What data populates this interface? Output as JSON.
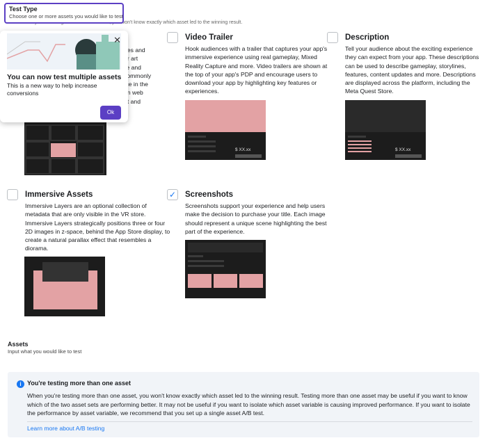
{
  "header": {
    "title": "Test Type",
    "subtitle": "Choose one or more assets you would like to test",
    "note": "Note: When you're testing more than one asset, you won't know exactly which asset led to the winning result."
  },
  "popover": {
    "title": "You can now test multiple assets",
    "body": "This is a new way to help increase conversions",
    "ok_label": "Ok",
    "close_glyph": "✕"
  },
  "hidden_card_fragments": [
    "ences and",
    "over art",
    "uare and",
    "st commonly",
    "ience in the",
    "ed in web",
    "dset and"
  ],
  "cards": {
    "video_trailer": {
      "title": "Video Trailer",
      "checked": false,
      "description": "Hook audiences with a trailer that captures your app's immersive experience using real gameplay, Mixed Reality Capture and more. Video trailers are shown at the top of your app's PDP and encourage users to download your app by highlighting key features or experiences.",
      "price": "$ XX.xx"
    },
    "description": {
      "title": "Description",
      "checked": false,
      "description": "Tell your audience about the exciting experience they can expect from your app. These descriptions can be used to describe gameplay, storylines, features, content updates and more. Descriptions are displayed across the platform, including the Meta Quest Store.",
      "price": "$ XX.xx"
    },
    "immersive_assets": {
      "title": "Immersive Assets",
      "checked": false,
      "description": "Immersive Layers are an optional collection of metadata that are only visible in the VR store. Immersive Layers strategically positions three or four 2D images in z-space, behind the App Store display, to create a natural parallax effect that resembles a diorama."
    },
    "screenshots": {
      "title": "Screenshots",
      "checked": true,
      "check_glyph": "✓",
      "description": "Screenshots support your experience and help users make the decision to purchase your title. Each image should represent a unique scene highlighting the best part of the experience."
    }
  },
  "assets": {
    "title": "Assets",
    "subtitle": "Input what you would like to test"
  },
  "info": {
    "icon": "i",
    "title": "You're testing more than one asset",
    "body": "When you're testing more than one asset, you won't know exactly which asset led to the winning result. Testing more than one asset may be useful if you want to know which of the two asset sets are performing better. It may not be useful if you want to isolate which asset variable is causing improved performance. If you want to isolate the performance by asset variable, we recommend that you set up a single asset A/B test.",
    "link": "Learn more about A/B testing"
  },
  "colors": {
    "accent": "#5b3fc4",
    "link": "#1877f2",
    "thumb_bg": "#1c1c1c",
    "thumb_pink": "#e3a2a4"
  }
}
